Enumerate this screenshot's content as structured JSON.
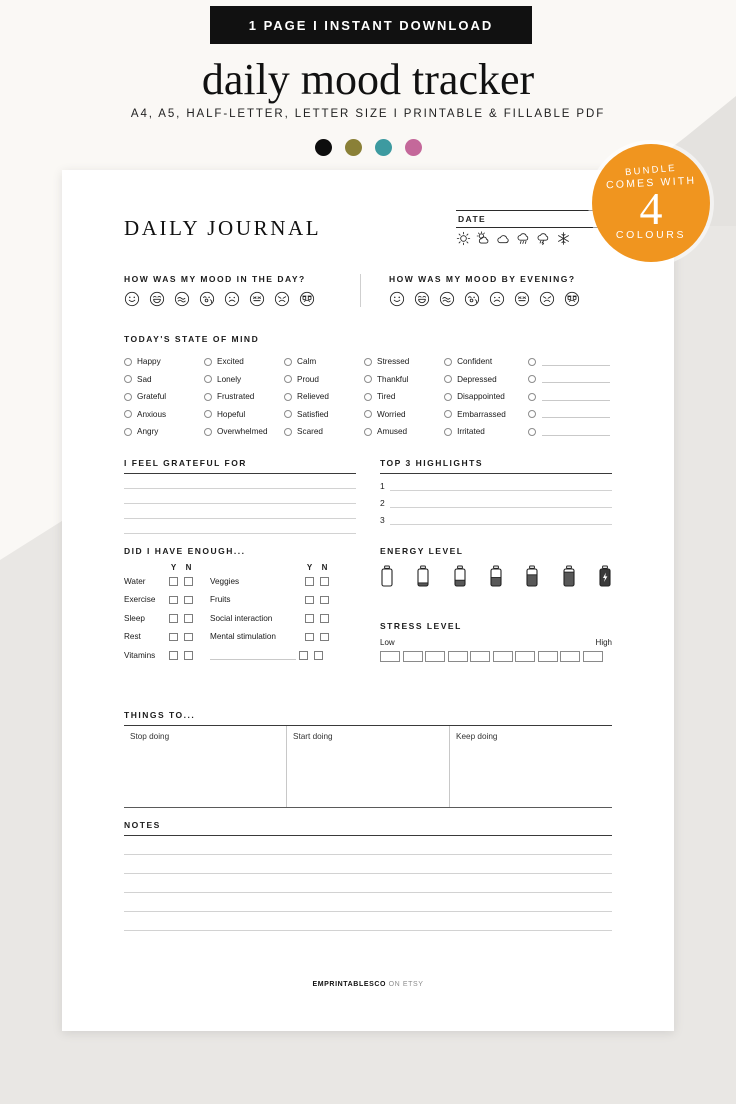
{
  "promo": {
    "banner": "1 PAGE I INSTANT DOWNLOAD",
    "title": "daily mood tracker",
    "subtitle": "A4, A5, HALF-LETTER, LETTER SIZE  I  PRINTABLE & FILLABLE PDF",
    "swatches": [
      {
        "name": "black",
        "hex": "#0d0d0d"
      },
      {
        "name": "olive",
        "hex": "#8a8037"
      },
      {
        "name": "teal",
        "hex": "#3d9aa0"
      },
      {
        "name": "pink",
        "hex": "#c4689a"
      }
    ]
  },
  "badge": {
    "line1": "BUNDLE",
    "line2": "COMES WITH",
    "number": "4",
    "line4": "COLOURS",
    "color": "#f0951f"
  },
  "sheet": {
    "title": "DAILY JOURNAL",
    "date_label": "DATE",
    "weather_icons": [
      "sun-icon",
      "sun-cloud-icon",
      "cloud-icon",
      "rain-icon",
      "storm-icon",
      "snowflake-icon"
    ],
    "mood": {
      "day_heading": "HOW WAS MY MOOD IN THE DAY?",
      "evening_heading": "HOW WAS MY MOOD BY EVENING?",
      "faces": [
        "smile-face-icon",
        "grin-face-icon",
        "smirk-face-icon",
        "sleepy-face-icon",
        "frown-face-icon",
        "grimace-face-icon",
        "sad-face-icon",
        "crying-face-icon"
      ]
    },
    "state_of_mind": {
      "heading": "TODAY'S STATE OF MIND",
      "columns": [
        [
          "Happy",
          "Sad",
          "Grateful",
          "Anxious",
          "Angry"
        ],
        [
          "Excited",
          "Lonely",
          "Frustrated",
          "Hopeful",
          "Overwhelmed"
        ],
        [
          "Calm",
          "Proud",
          "Relieved",
          "Satisfied",
          "Scared"
        ],
        [
          "Stressed",
          "Thankful",
          "Tired",
          "Worried",
          "Amused"
        ],
        [
          "Confident",
          "Depressed",
          "Disappointed",
          "Embarrassed",
          "Irritated"
        ],
        [
          "",
          "",
          "",
          "",
          ""
        ]
      ]
    },
    "grateful": {
      "heading": "I FEEL GRATEFUL FOR",
      "lines": 4
    },
    "highlights": {
      "heading": "TOP 3 HIGHLIGHTS",
      "numbers": [
        "1",
        "2",
        "3"
      ]
    },
    "enough": {
      "heading": "DID I HAVE ENOUGH...",
      "yes_label": "Y",
      "no_label": "N",
      "left_items": [
        "Water",
        "Exercise",
        "Sleep",
        "Rest",
        "Vitamins"
      ],
      "right_items": [
        "Veggies",
        "Fruits",
        "Social interaction",
        "Mental stimulation",
        ""
      ]
    },
    "energy": {
      "heading": "ENERGY LEVEL",
      "steps": 7
    },
    "stress": {
      "heading": "STRESS LEVEL",
      "low_label": "Low",
      "high_label": "High",
      "boxes": 10
    },
    "things": {
      "heading": "THINGS TO...",
      "columns": [
        "Stop doing",
        "Start doing",
        "Keep doing"
      ]
    },
    "notes": {
      "heading": "NOTES",
      "lines": 5
    },
    "footer_brand": "EMPRINTABLESCO",
    "footer_rest": " ON ETSY"
  }
}
